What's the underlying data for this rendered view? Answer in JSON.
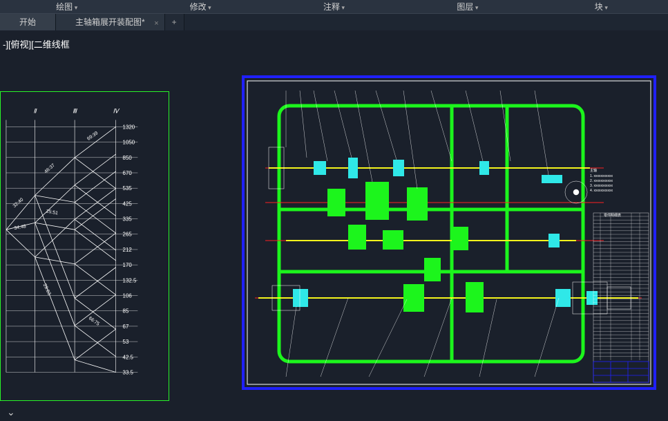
{
  "menubar": {
    "items": [
      "绘图",
      "修改",
      "注释",
      "图层",
      "块"
    ]
  },
  "tabs": {
    "start": "开始",
    "doc": "主轴箱展开装配图*",
    "add": "+"
  },
  "view_label": "-][俯视][二维线框",
  "cmd_indicator": "⌄",
  "chart_data": {
    "type": "line",
    "title": "",
    "col_headers": [
      "Ⅱ",
      "Ⅲ",
      "Ⅳ"
    ],
    "y_ticks": [
      1320,
      1050,
      850,
      670,
      535,
      425,
      335,
      265,
      212,
      170,
      132.5,
      106,
      85,
      67,
      53,
      42.5,
      33.5
    ],
    "edge_labels": [
      "32:40",
      "34:48",
      "46:37",
      "25:51",
      "29:63",
      "69:39",
      "66:75"
    ]
  },
  "drawing": {
    "title_note": "主轴",
    "table_header": "零件明细表"
  }
}
